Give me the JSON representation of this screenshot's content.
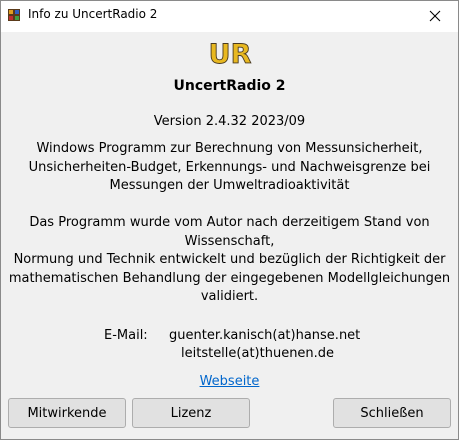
{
  "window": {
    "title": "Info zu UncertRadio 2"
  },
  "logo": {
    "text": "UR"
  },
  "about": {
    "app_name": "UncertRadio 2",
    "version": "Version 2.4.32 2023/09",
    "description_lines": [
      "Windows Programm zur Berechnung von Messunsicherheit,",
      "Unsicherheiten-Budget, Erkennungs- und Nachweisgrenze bei",
      "Messungen der Umweltradioaktivität"
    ],
    "disclaimer_lines": [
      "Das Programm wurde vom Autor nach derzeitigem Stand von",
      "Wissenschaft,",
      "Normung und Technik entwickelt und bezüglich der Richtigkeit der",
      "mathematischen Behandlung der eingegebenen Modellgleichungen",
      "validiert."
    ],
    "email_label": "E-Mail:",
    "emails": [
      "guenter.kanisch(at)hanse.net",
      "leitstelle(at)thuenen.de"
    ],
    "website_link": "Webseite"
  },
  "buttons": {
    "contributors": "Mitwirkende",
    "license": "Lizenz",
    "close": "Schließen"
  }
}
